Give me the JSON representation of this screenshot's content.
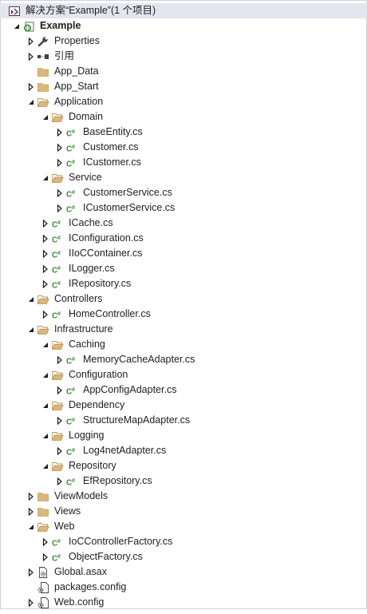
{
  "tree": [
    {
      "label": "解决方案“Example”(1 个项目)",
      "icon": "solution-icon",
      "depth": 0,
      "expander": "none",
      "selected": true
    },
    {
      "label": "Example",
      "icon": "csharp-project-icon",
      "depth": 1,
      "expander": "expanded",
      "bold": true
    },
    {
      "label": "Properties",
      "icon": "wrench-icon",
      "depth": 2,
      "expander": "collapsed"
    },
    {
      "label": "引用",
      "icon": "references-icon",
      "depth": 2,
      "expander": "collapsed"
    },
    {
      "label": "App_Data",
      "icon": "folder-icon",
      "depth": 2,
      "expander": "none"
    },
    {
      "label": "App_Start",
      "icon": "folder-icon",
      "depth": 2,
      "expander": "collapsed"
    },
    {
      "label": "Application",
      "icon": "folder-open-icon",
      "depth": 2,
      "expander": "expanded"
    },
    {
      "label": "Domain",
      "icon": "folder-open-icon",
      "depth": 3,
      "expander": "expanded"
    },
    {
      "label": "BaseEntity.cs",
      "icon": "csharp-file-icon",
      "depth": 4,
      "expander": "collapsed"
    },
    {
      "label": "Customer.cs",
      "icon": "csharp-file-icon",
      "depth": 4,
      "expander": "collapsed"
    },
    {
      "label": "ICustomer.cs",
      "icon": "csharp-file-icon",
      "depth": 4,
      "expander": "collapsed"
    },
    {
      "label": "Service",
      "icon": "folder-open-icon",
      "depth": 3,
      "expander": "expanded"
    },
    {
      "label": "CustomerService.cs",
      "icon": "csharp-file-icon",
      "depth": 4,
      "expander": "collapsed"
    },
    {
      "label": "ICustomerService.cs",
      "icon": "csharp-file-icon",
      "depth": 4,
      "expander": "collapsed"
    },
    {
      "label": "ICache.cs",
      "icon": "csharp-file-icon",
      "depth": 3,
      "expander": "collapsed"
    },
    {
      "label": "IConfiguration.cs",
      "icon": "csharp-file-icon",
      "depth": 3,
      "expander": "collapsed"
    },
    {
      "label": "IIoCContainer.cs",
      "icon": "csharp-file-icon",
      "depth": 3,
      "expander": "collapsed"
    },
    {
      "label": "ILogger.cs",
      "icon": "csharp-file-icon",
      "depth": 3,
      "expander": "collapsed"
    },
    {
      "label": "IRepository.cs",
      "icon": "csharp-file-icon",
      "depth": 3,
      "expander": "collapsed"
    },
    {
      "label": "Controllers",
      "icon": "folder-open-icon",
      "depth": 2,
      "expander": "expanded"
    },
    {
      "label": "HomeController.cs",
      "icon": "csharp-file-icon",
      "depth": 3,
      "expander": "collapsed"
    },
    {
      "label": "Infrastructure",
      "icon": "folder-open-icon",
      "depth": 2,
      "expander": "expanded"
    },
    {
      "label": "Caching",
      "icon": "folder-open-icon",
      "depth": 3,
      "expander": "expanded"
    },
    {
      "label": "MemoryCacheAdapter.cs",
      "icon": "csharp-file-icon",
      "depth": 4,
      "expander": "collapsed"
    },
    {
      "label": "Configuration",
      "icon": "folder-open-icon",
      "depth": 3,
      "expander": "expanded"
    },
    {
      "label": "AppConfigAdapter.cs",
      "icon": "csharp-file-icon",
      "depth": 4,
      "expander": "collapsed"
    },
    {
      "label": "Dependency",
      "icon": "folder-open-icon",
      "depth": 3,
      "expander": "expanded"
    },
    {
      "label": "StructureMapAdapter.cs",
      "icon": "csharp-file-icon",
      "depth": 4,
      "expander": "collapsed"
    },
    {
      "label": "Logging",
      "icon": "folder-open-icon",
      "depth": 3,
      "expander": "expanded"
    },
    {
      "label": "Log4netAdapter.cs",
      "icon": "csharp-file-icon",
      "depth": 4,
      "expander": "collapsed"
    },
    {
      "label": "Repository",
      "icon": "folder-open-icon",
      "depth": 3,
      "expander": "expanded"
    },
    {
      "label": "EfRepository.cs",
      "icon": "csharp-file-icon",
      "depth": 4,
      "expander": "collapsed"
    },
    {
      "label": "ViewModels",
      "icon": "folder-icon",
      "depth": 2,
      "expander": "collapsed"
    },
    {
      "label": "Views",
      "icon": "folder-icon",
      "depth": 2,
      "expander": "collapsed"
    },
    {
      "label": "Web",
      "icon": "folder-open-icon",
      "depth": 2,
      "expander": "expanded"
    },
    {
      "label": "IoCControllerFactory.cs",
      "icon": "csharp-file-icon",
      "depth": 3,
      "expander": "collapsed"
    },
    {
      "label": "ObjectFactory.cs",
      "icon": "csharp-file-icon",
      "depth": 3,
      "expander": "collapsed"
    },
    {
      "label": "Global.asax",
      "icon": "asax-file-icon",
      "depth": 2,
      "expander": "collapsed"
    },
    {
      "label": "packages.config",
      "icon": "config-file-icon",
      "depth": 2,
      "expander": "none"
    },
    {
      "label": "Web.config",
      "icon": "config-file-icon",
      "depth": 2,
      "expander": "collapsed"
    }
  ],
  "colors": {
    "folder": "#dcb67a",
    "csharp": "#388a34",
    "selection": "#e5e5f0",
    "expander": "#1e1e1e",
    "solution_purple": "#68217a",
    "project_green": "#388a34"
  }
}
